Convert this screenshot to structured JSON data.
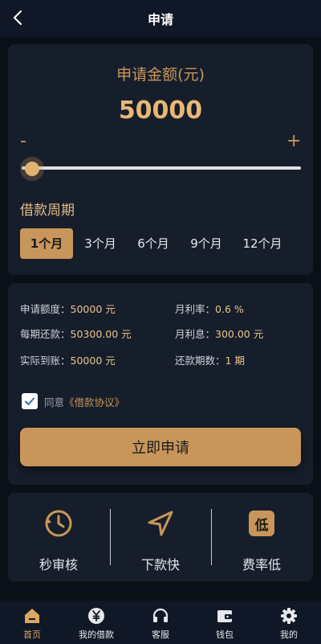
{
  "header": {
    "title": "申请"
  },
  "amount": {
    "label": "申请金额(元)",
    "value": "50000",
    "minus": "-",
    "plus": "+"
  },
  "slider": {
    "level": 0.0
  },
  "period": {
    "label": "借款周期",
    "options": [
      "1个月",
      "3个月",
      "6个月",
      "9个月",
      "12个月"
    ],
    "selected": "1个月"
  },
  "summary": {
    "quota_label": "申请额度：",
    "quota_value": "50000 元",
    "monthly_rate_label": "月利率：",
    "monthly_rate_value": "0.6 %",
    "repay_label": "每期还款：",
    "repay_value": "50300.00 元",
    "interest_label": "月利息：",
    "interest_value": "300.00 元",
    "received_label": "实际到账：",
    "received_value": "50000 元",
    "periods_label": "还款期数：",
    "periods_value": "1 期"
  },
  "agreement": {
    "checked": true,
    "prefix": "同意",
    "link": "《借款协议》"
  },
  "apply_button": "立即申请",
  "features": [
    {
      "icon": "clock-icon",
      "label": "秒审核"
    },
    {
      "icon": "send-icon",
      "label": "下款快"
    },
    {
      "icon": "low-badge-icon",
      "badge": "低",
      "label": "费率低"
    }
  ],
  "tabbar": [
    {
      "icon": "home-icon",
      "label": "首页",
      "active": true
    },
    {
      "icon": "yen-icon",
      "label": "我的借款",
      "active": false
    },
    {
      "icon": "headset-icon",
      "label": "客服",
      "active": false
    },
    {
      "icon": "wallet-icon",
      "label": "钱包",
      "active": false
    },
    {
      "icon": "gear-icon",
      "label": "我的",
      "active": false
    }
  ],
  "colors": {
    "accent": "#c8965a",
    "background": "#0b0f17",
    "card": "#171e2b",
    "bar": "#101726"
  }
}
